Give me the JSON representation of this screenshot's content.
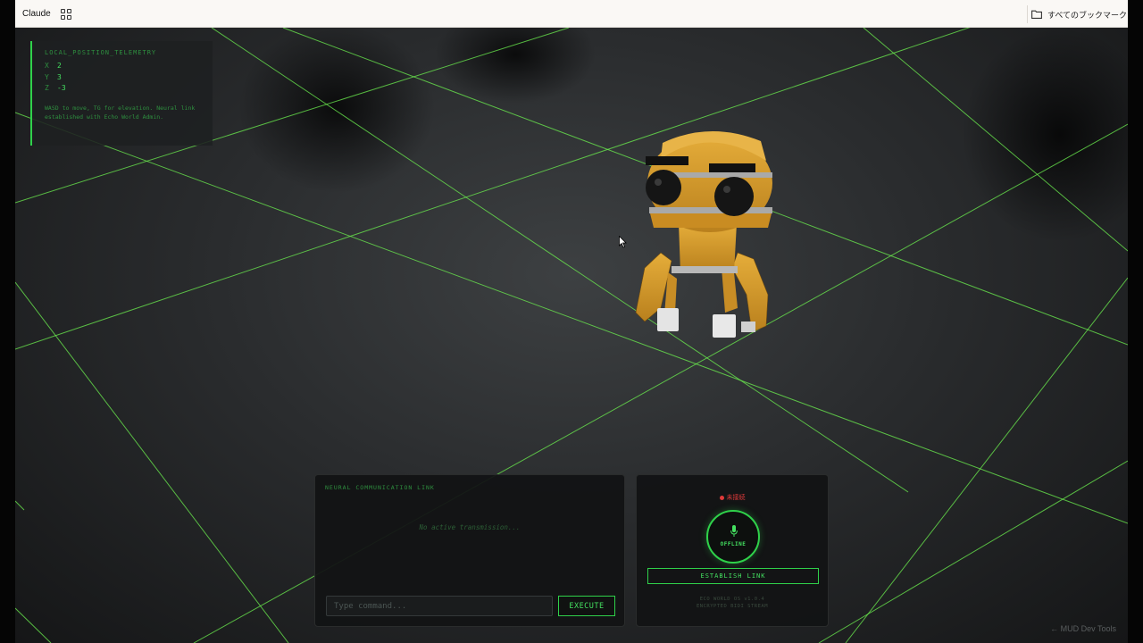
{
  "browser": {
    "tab_label": "Claude",
    "apps_icon": "apps-grid-icon",
    "bookmarks_label": "すべてのブックマーク",
    "bookmarks_icon": "folder-icon"
  },
  "telemetry": {
    "title": "LOCAL_POSITION_TELEMETRY",
    "x_label": "X",
    "x_value": "2",
    "y_label": "Y",
    "y_value": "3",
    "z_label": "Z",
    "z_value": "-3",
    "help": "WASD to move, TG for elevation. Neural link established with Echo World Admin."
  },
  "comm": {
    "title": "NEURAL COMMUNICATION LINK",
    "empty_text": "No active transmission...",
    "input_placeholder": "Type command...",
    "execute_label": "EXECUTE"
  },
  "voice": {
    "status_text": "未接続",
    "status_color": "#e03a3a",
    "mic_icon": "microphone-icon",
    "mic_label": "OFFLINE",
    "establish_label": "ESTABLISH LINK",
    "version_line1": "ECO WORLD OS v1.0.4",
    "version_line2": "ENCRYPTED BIDI STREAM"
  },
  "devtools_label": "← MUD Dev Tools",
  "colors": {
    "accent_green": "#2fd14a",
    "robot_gold": "#d69a2c",
    "grid_line": "#7cff5a"
  }
}
